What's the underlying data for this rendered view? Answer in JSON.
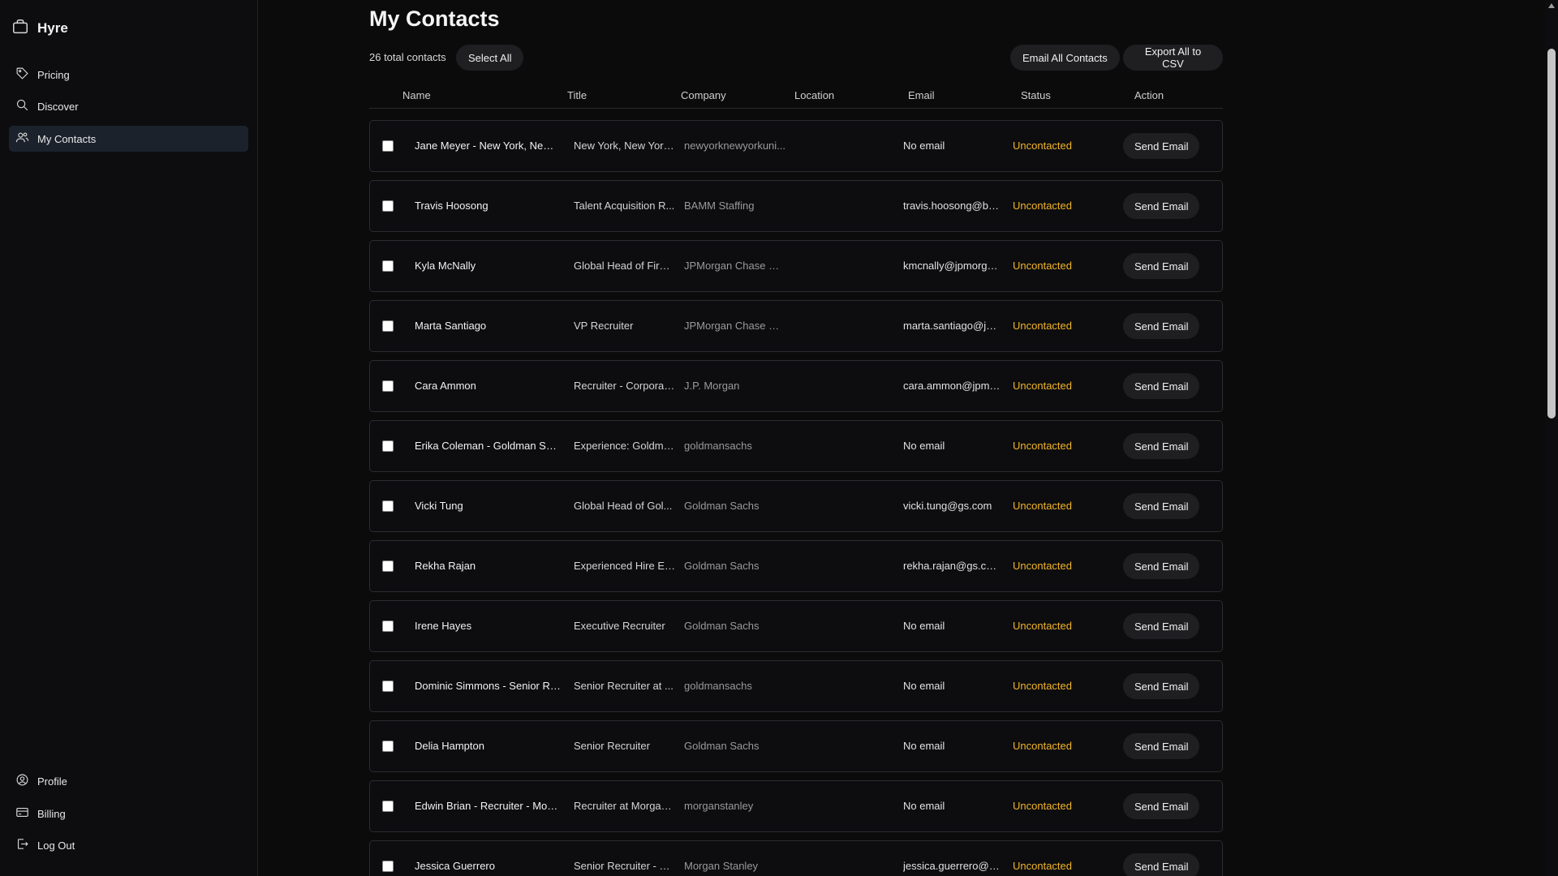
{
  "app": {
    "name": "Hyre"
  },
  "sidebar": {
    "top_items": [
      {
        "label": "Pricing",
        "icon": "tag-icon"
      },
      {
        "label": "Discover",
        "icon": "search-icon"
      },
      {
        "label": "My Contacts",
        "icon": "users-icon",
        "active": true
      }
    ],
    "bottom_items": [
      {
        "label": "Profile",
        "icon": "user-circle-icon"
      },
      {
        "label": "Billing",
        "icon": "credit-card-icon"
      },
      {
        "label": "Log Out",
        "icon": "logout-icon"
      }
    ]
  },
  "main": {
    "title": "My Contacts",
    "total_label": "26 total contacts",
    "select_all_label": "Select All",
    "email_all_label": "Email All Contacts",
    "export_label": "Export All to CSV",
    "columns": [
      "Name",
      "Title",
      "Company",
      "Location",
      "Email",
      "Status",
      "Action"
    ],
    "rows": [
      {
        "name": "Jane Meyer - New York, New Y...",
        "title": "New York, New York...",
        "company": "newyorknewyorkuni...",
        "location": "",
        "email": "No email",
        "status": "Uncontacted",
        "action": "Send Email"
      },
      {
        "name": "Travis Hoosong",
        "title": "Talent Acquisition R...",
        "company": "BAMM Staffing",
        "location": "",
        "email": "travis.hoosong@ba...",
        "status": "Uncontacted",
        "action": "Send Email"
      },
      {
        "name": "Kyla McNally",
        "title": "Global Head of Firm...",
        "company": "JPMorgan Chase & ...",
        "location": "",
        "email": "kmcnally@jpmorga...",
        "status": "Uncontacted",
        "action": "Send Email"
      },
      {
        "name": "Marta Santiago",
        "title": "VP Recruiter",
        "company": "JPMorgan Chase & ...",
        "location": "",
        "email": "marta.santiago@jp...",
        "status": "Uncontacted",
        "action": "Send Email"
      },
      {
        "name": "Cara Ammon",
        "title": "Recruiter - Corporat...",
        "company": "J.P. Morgan",
        "location": "",
        "email": "cara.ammon@jpmo...",
        "status": "Uncontacted",
        "action": "Send Email"
      },
      {
        "name": "Erika Coleman - Goldman Sachs",
        "title": "Experience: Goldma...",
        "company": "goldmansachs",
        "location": "",
        "email": "No email",
        "status": "Uncontacted",
        "action": "Send Email"
      },
      {
        "name": "Vicki Tung",
        "title": "Global Head of Gol...",
        "company": "Goldman Sachs",
        "location": "",
        "email": "vicki.tung@gs.com",
        "status": "Uncontacted",
        "action": "Send Email"
      },
      {
        "name": "Rekha Rajan",
        "title": "Experienced Hire En...",
        "company": "Goldman Sachs",
        "location": "",
        "email": "rekha.rajan@gs.com",
        "status": "Uncontacted",
        "action": "Send Email"
      },
      {
        "name": "Irene Hayes",
        "title": "Executive Recruiter",
        "company": "Goldman Sachs",
        "location": "",
        "email": "No email",
        "status": "Uncontacted",
        "action": "Send Email"
      },
      {
        "name": "Dominic Simmons - Senior Rec...",
        "title": "Senior Recruiter at ...",
        "company": "goldmansachs",
        "location": "",
        "email": "No email",
        "status": "Uncontacted",
        "action": "Send Email"
      },
      {
        "name": "Delia Hampton",
        "title": "Senior Recruiter",
        "company": "Goldman Sachs",
        "location": "",
        "email": "No email",
        "status": "Uncontacted",
        "action": "Send Email"
      },
      {
        "name": "Edwin Brian - Recruiter - Morg...",
        "title": "Recruiter at Morgan...",
        "company": "morganstanley",
        "location": "",
        "email": "No email",
        "status": "Uncontacted",
        "action": "Send Email"
      },
      {
        "name": "Jessica Guerrero",
        "title": "Senior Recruiter - H...",
        "company": "Morgan Stanley",
        "location": "",
        "email": "jessica.guerrero@m...",
        "status": "Uncontacted",
        "action": "Send Email"
      }
    ]
  },
  "colors": {
    "background": "#0b0b0c",
    "status_uncontacted": "#f0b429",
    "active_nav": "#1c222c"
  }
}
